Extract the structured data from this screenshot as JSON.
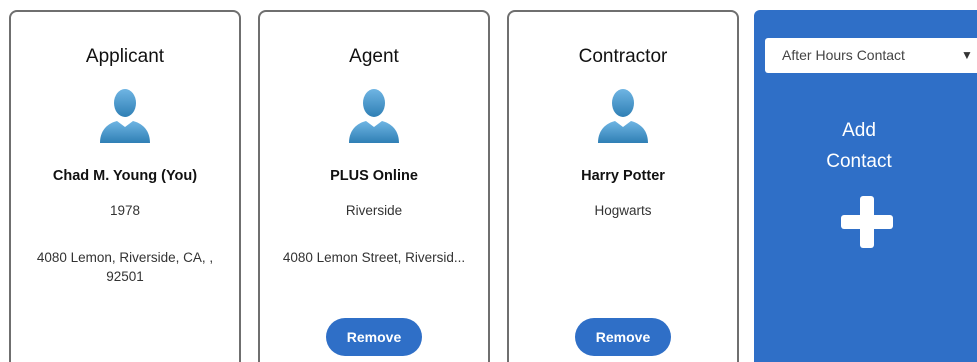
{
  "cards": [
    {
      "role": "Applicant",
      "name": "Chad M. Young (You)",
      "detail": "1978",
      "address": "4080 Lemon, Riverside, CA, , 92501",
      "icon": "user-avatar-icon"
    },
    {
      "role": "Agent",
      "name": "PLUS Online",
      "detail": "Riverside",
      "address": "4080 Lemon Street, Riversid...",
      "remove_label": "Remove",
      "icon": "user-avatar-icon"
    },
    {
      "role": "Contractor",
      "name": "Harry Potter",
      "detail": "Hogwarts",
      "remove_label": "Remove",
      "icon": "user-avatar-icon"
    }
  ],
  "add_contact": {
    "select_value": "After Hours Contact",
    "arrow": "▼",
    "label_line1": "Add",
    "label_line2": "Contact",
    "icon": "plus-icon"
  },
  "colors": {
    "accent": "#2f6fc7",
    "card_border": "#6f6f6f",
    "avatar": "#3d8fc4"
  }
}
